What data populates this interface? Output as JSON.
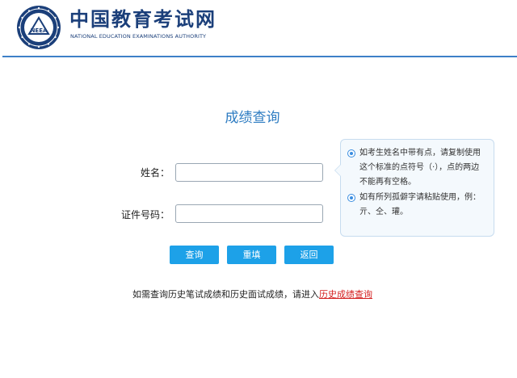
{
  "header": {
    "brand_cn": "中国教育考试网",
    "brand_en": "NATIONAL EDUCATION EXAMINATIONS AUTHORITY",
    "logo_text": "NEEA"
  },
  "main": {
    "title": "成绩查询",
    "form": {
      "name_label": "姓名：",
      "name_value": "",
      "id_label": "证件号码：",
      "id_value": ""
    },
    "tips": [
      "如考生姓名中带有点，请复制使用这个标准的点符号（·），点的两边不能再有空格。",
      "如有所列孤僻字请粘贴使用，例：亓、仝、瓘。"
    ],
    "buttons": {
      "query": "查询",
      "reset": "重填",
      "back": "返回"
    },
    "footer": {
      "text": "如需查询历史笔试成绩和历史面试成绩，请进入",
      "link": "历史成绩查询"
    }
  },
  "colors": {
    "brand": "#1b3f7a",
    "accent": "#2e7cc2",
    "button": "#1da1e8",
    "link": "#d42020"
  }
}
